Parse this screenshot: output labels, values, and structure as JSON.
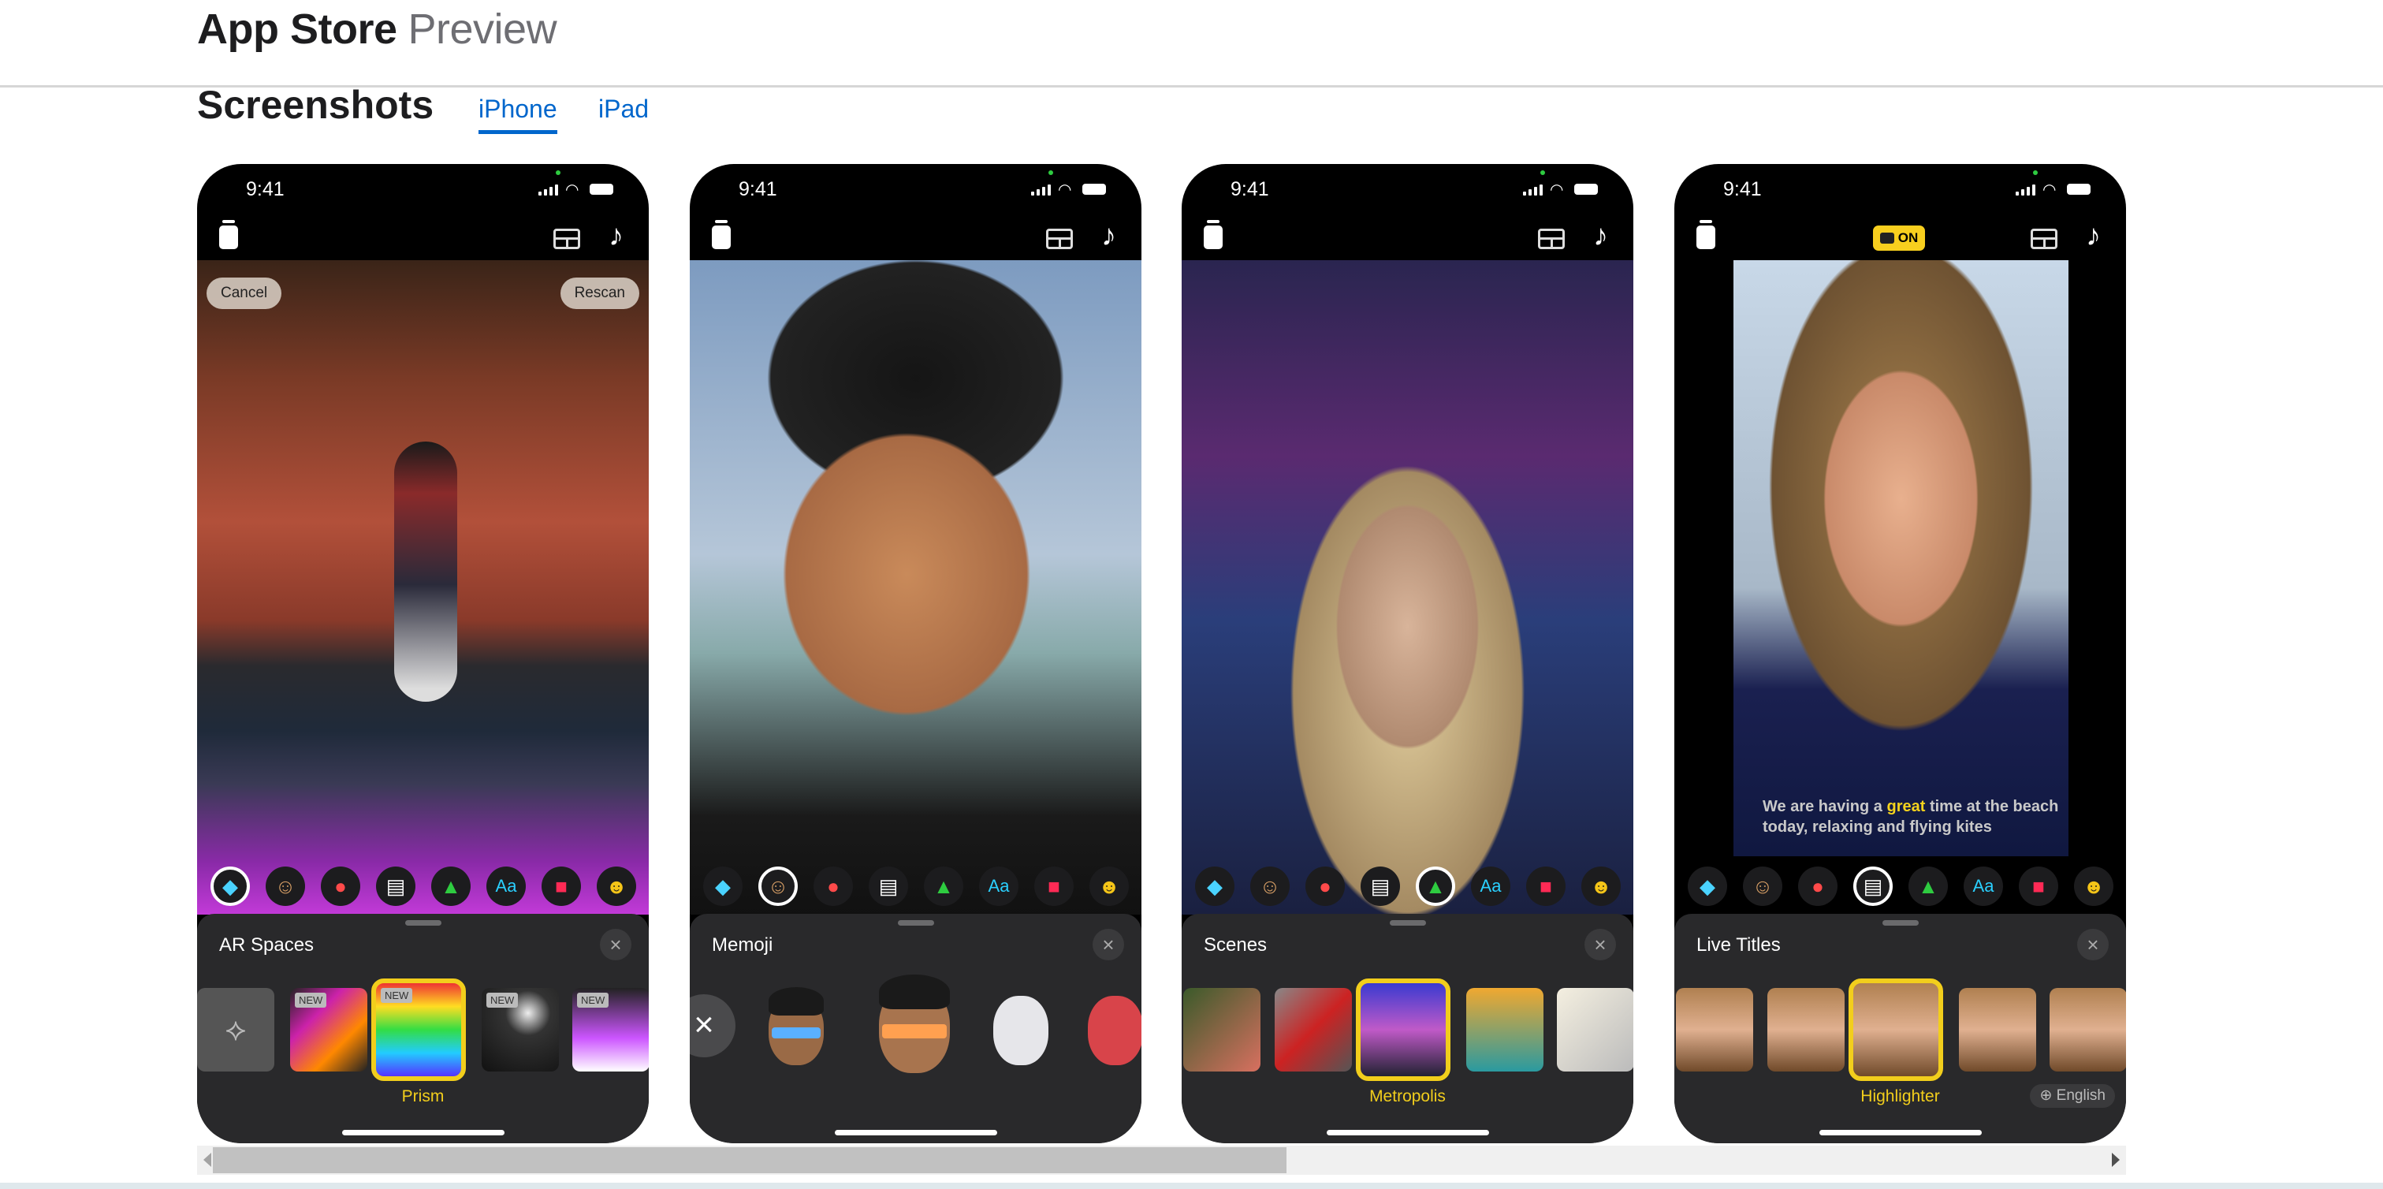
{
  "header": {
    "title": "App Store",
    "subtitle": "Preview"
  },
  "section": {
    "title": "Screenshots",
    "tabs": [
      {
        "label": "iPhone",
        "active": true
      },
      {
        "label": "iPad",
        "active": false
      }
    ]
  },
  "accent_color": "#0066cc",
  "selection_color": "#f2ce1c",
  "toolbar_icons": [
    "ar-spaces-icon",
    "memoji-icon",
    "filters-icon",
    "live-titles-icon",
    "scenes-icon",
    "text-icon",
    "stickers-icon",
    "emoji-icon"
  ],
  "phones": [
    {
      "time": "9:41",
      "sheet_title": "AR Spaces",
      "selected_label": "Prism",
      "selected_tool": 0,
      "buttons": {
        "cancel": "Cancel",
        "rescan": "Rescan"
      },
      "thumbs": [
        {
          "kind": "scan"
        },
        {
          "badge": "NEW"
        },
        {
          "badge": "NEW",
          "selected": true
        },
        {
          "badge": "NEW"
        },
        {
          "badge": "NEW"
        }
      ]
    },
    {
      "time": "9:41",
      "sheet_title": "Memoji",
      "selected_tool": 1,
      "thumbs": [
        {
          "kind": "none"
        },
        {
          "kind": "memoji-blue"
        },
        {
          "kind": "memoji-orange"
        },
        {
          "kind": "mouse"
        },
        {
          "kind": "octopus"
        }
      ]
    },
    {
      "time": "9:41",
      "sheet_title": "Scenes",
      "selected_label": "Metropolis",
      "selected_tool": 4,
      "thumbs": [
        {},
        {},
        {
          "selected": true
        },
        {},
        {}
      ]
    },
    {
      "time": "9:41",
      "sheet_title": "Live Titles",
      "selected_label": "Highlighter",
      "selected_tool": 3,
      "live_titles_badge": "ON",
      "caption": {
        "before": "We are having a ",
        "highlight": "great",
        "after": " time at the beach today, relaxing and flying kites"
      },
      "language": "English",
      "thumbs": [
        {},
        {},
        {
          "selected": true
        },
        {},
        {}
      ]
    }
  ]
}
